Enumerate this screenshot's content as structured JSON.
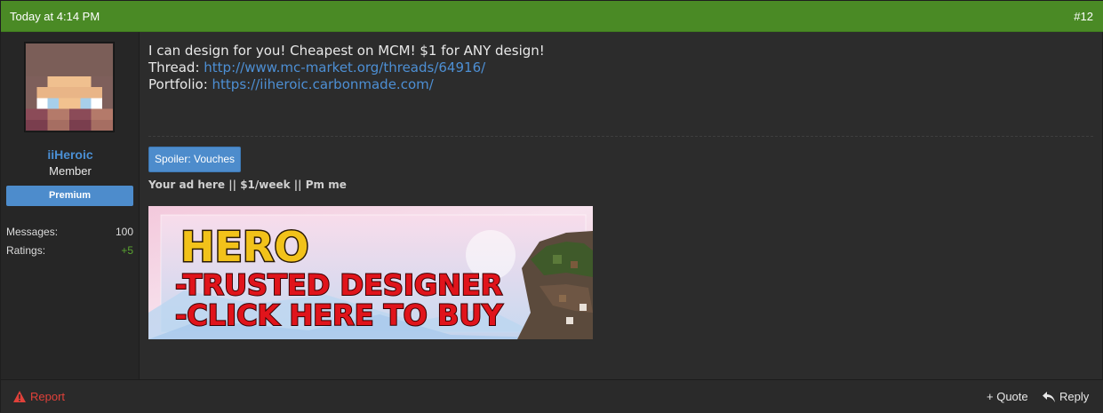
{
  "header": {
    "date": "Today at 4:14 PM",
    "post_number": "#12"
  },
  "author": {
    "username": "iiHeroic",
    "role": "Member",
    "badge": "Premium",
    "stats": [
      {
        "label": "Messages:",
        "value": "100"
      },
      {
        "label": "Ratings:",
        "value": "+5"
      }
    ]
  },
  "message": {
    "line1": "I can design for you! Cheapest on MCM! $1 for ANY design!",
    "thread_label": "Thread: ",
    "thread_url": "http://www.mc-market.org/threads/64916/",
    "portfolio_label": "Portfolio: ",
    "portfolio_url": "https://iiheroic.carbonmade.com/"
  },
  "signature": {
    "spoiler_label": "Spoiler: Vouches",
    "ad_text": "Your ad here || $1/week || Pm me",
    "banner": {
      "title": "HERO",
      "line2": "-TRUSTED DESIGNER",
      "line3": "-CLICK HERE TO BUY"
    }
  },
  "footer": {
    "report": "Report",
    "quote": "+ Quote",
    "reply": "Reply"
  },
  "colors": {
    "header": "#4a8a25",
    "link": "#4d8fd4",
    "badge": "#4d8ccc",
    "report": "#e0413a",
    "banner_text_red": "#e0141b",
    "banner_title_yellow": "#f2c21a"
  }
}
